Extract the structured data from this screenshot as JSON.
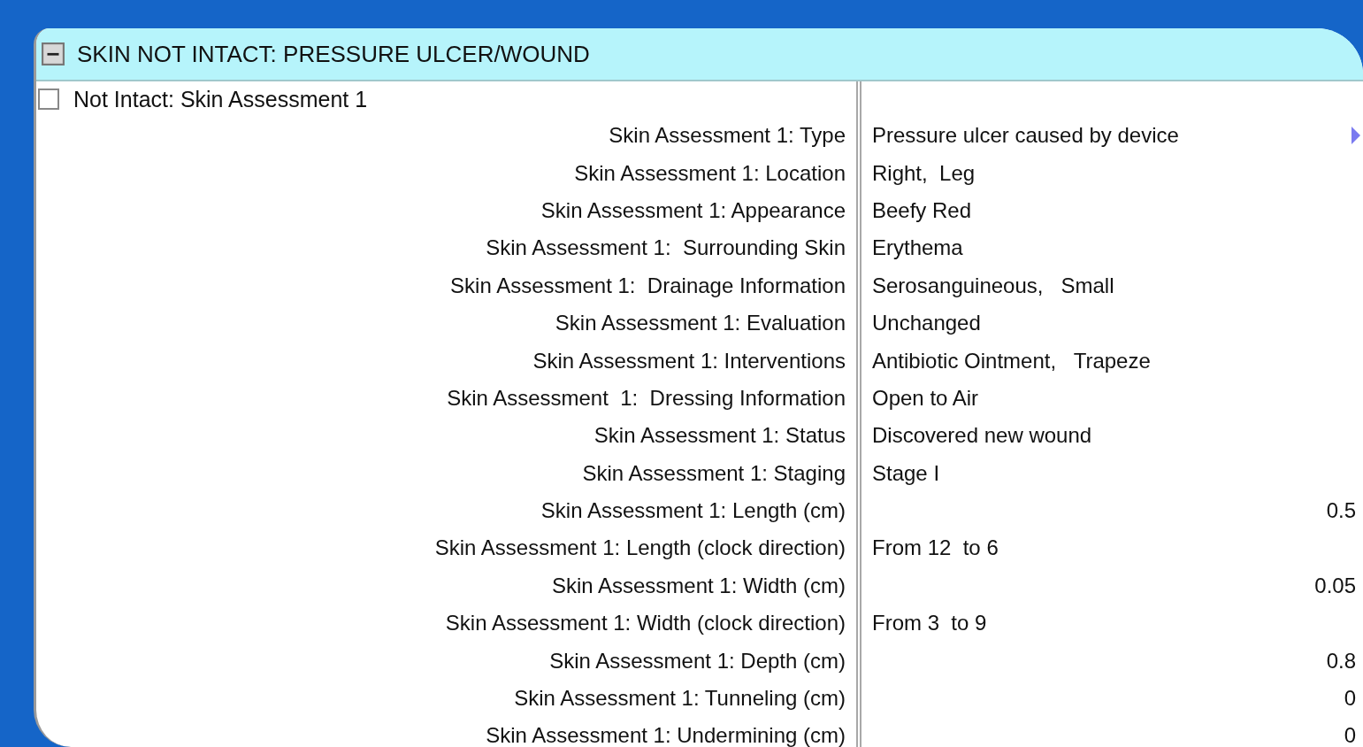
{
  "section": {
    "title": "SKIN NOT INTACT: PRESSURE ULCER/WOUND",
    "expanded": true
  },
  "checkbox": {
    "label": "Not Intact: Skin Assessment 1",
    "checked": false
  },
  "rows": [
    {
      "label": "Skin Assessment 1: Type",
      "value": "Pressure ulcer caused by device",
      "kind": "dropdown"
    },
    {
      "label": "Skin Assessment 1: Location",
      "value": "Right,  Leg",
      "kind": "text"
    },
    {
      "label": "Skin Assessment 1: Appearance",
      "value": "Beefy Red",
      "kind": "text"
    },
    {
      "label": "Skin Assessment 1:  Surrounding Skin",
      "value": "Erythema",
      "kind": "text"
    },
    {
      "label": "Skin Assessment 1:  Drainage Information",
      "value": "Serosanguineous,   Small",
      "kind": "text"
    },
    {
      "label": "Skin Assessment 1: Evaluation",
      "value": "Unchanged",
      "kind": "text"
    },
    {
      "label": "Skin Assessment 1: Interventions",
      "value": "Antibiotic Ointment,   Trapeze",
      "kind": "text"
    },
    {
      "label": "Skin Assessment  1:  Dressing Information",
      "value": "Open to Air",
      "kind": "text"
    },
    {
      "label": "Skin Assessment 1: Status",
      "value": "Discovered new wound",
      "kind": "text"
    },
    {
      "label": "Skin Assessment 1: Staging",
      "value": "Stage I",
      "kind": "text"
    },
    {
      "label": "Skin Assessment 1: Length (cm)",
      "value": "0.5",
      "kind": "number"
    },
    {
      "label": "Skin Assessment 1: Length (clock direction)",
      "value": "From 12  to 6",
      "kind": "text"
    },
    {
      "label": "Skin Assessment 1: Width (cm)",
      "value": "0.05",
      "kind": "number"
    },
    {
      "label": "Skin Assessment 1: Width (clock direction)",
      "value": "From 3  to 9",
      "kind": "text"
    },
    {
      "label": "Skin Assessment 1: Depth (cm)",
      "value": "0.8",
      "kind": "number"
    },
    {
      "label": "Skin Assessment 1: Tunneling (cm)",
      "value": "0",
      "kind": "number"
    },
    {
      "label": "Skin Assessment 1: Undermining (cm)",
      "value": "0",
      "kind": "number"
    }
  ]
}
